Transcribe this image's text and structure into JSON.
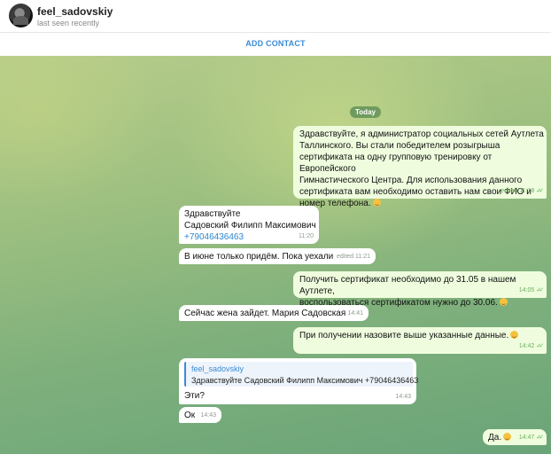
{
  "header": {
    "name": "feel_sadovskiy",
    "status": "last seen recently",
    "add_contact_label": "ADD CONTACT"
  },
  "chat": {
    "day_label": "Today",
    "messages": [
      {
        "id": "m1",
        "direction": "out",
        "text": "Здравствуйте, я администратор социальных сетей Аутлета\nТаллинского. Вы стали победителем розыгрыша\nсертификата на одну групповую тренировку от Европейского\nГимнастического Центра. Для использования данного\nсертификата вам необходимо оставить нам свои ФИО и\nномер телефона.",
        "emoji": "smirk-emoji",
        "meta": "edited 11:18",
        "read": true
      },
      {
        "id": "m2",
        "direction": "in",
        "text": "Здравствуйте\nСадовский Филипп Максимович",
        "phone": "+79046436463",
        "meta": "11:20"
      },
      {
        "id": "m3",
        "direction": "in",
        "text": "В июне только придём. Пока уехали",
        "meta": "edited 11:21"
      },
      {
        "id": "m4",
        "direction": "out",
        "text": "Получить сертификат необходимо до 31.05 в нашем Аутлете,\nвоспользоваться сертификатом нужно до 30.06.",
        "emoji": "smirk-emoji",
        "meta": "14:05",
        "read": true
      },
      {
        "id": "m5",
        "direction": "in",
        "text": "Сейчас жена зайдет. Мария Садовская",
        "meta": "14:41"
      },
      {
        "id": "m6",
        "direction": "out",
        "text": "При получении назовите выше указанные данные.",
        "emoji": "smirk-emoji",
        "meta": "14:42",
        "read": true
      },
      {
        "id": "m7",
        "direction": "in",
        "reply": {
          "name": "feel_sadovskiy",
          "text": "Здравствуйте Садовский Филипп Максимович +79046436463"
        },
        "text": "Эти?",
        "meta": "14:43"
      },
      {
        "id": "m8",
        "direction": "in",
        "text": "Ок",
        "meta": "14:43"
      },
      {
        "id": "m9",
        "direction": "out",
        "text": "Да.",
        "emoji": "smirk-emoji",
        "meta": "14:47",
        "read": true
      }
    ]
  },
  "colors": {
    "accent": "#3a8bd6",
    "outgoing_bubble": "#effdde",
    "incoming_bubble": "#ffffff",
    "read_ticks": "#4fae4e"
  }
}
